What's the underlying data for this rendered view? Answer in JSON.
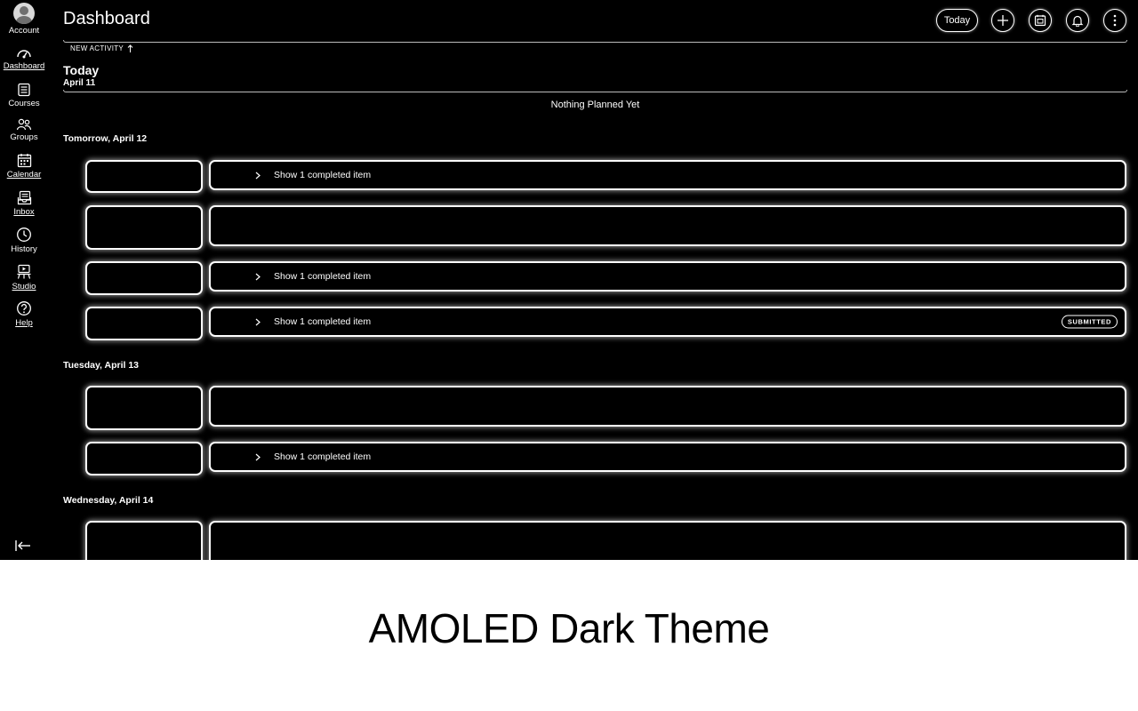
{
  "header": {
    "title": "Dashboard",
    "today_button": "Today"
  },
  "nav": {
    "account": "Account",
    "dashboard": "Dashboard",
    "courses": "Courses",
    "groups": "Groups",
    "calendar": "Calendar",
    "inbox": "Inbox",
    "history": "History",
    "studio": "Studio",
    "help": "Help"
  },
  "planner": {
    "new_activity": "NEW ACTIVITY",
    "today_label": "Today",
    "today_date": "April 11",
    "nothing_planned": "Nothing Planned Yet",
    "days": [
      {
        "label": "Tomorrow, April 12"
      },
      {
        "label": "Tuesday, April 13"
      },
      {
        "label": "Wednesday, April 14"
      }
    ],
    "show_completed": "Show 1 completed item",
    "submitted_badge": "SUBMITTED"
  },
  "caption": "AMOLED Dark Theme",
  "colors": {
    "background": "#000000",
    "foreground": "#ffffff",
    "caption_background": "#ffffff"
  }
}
